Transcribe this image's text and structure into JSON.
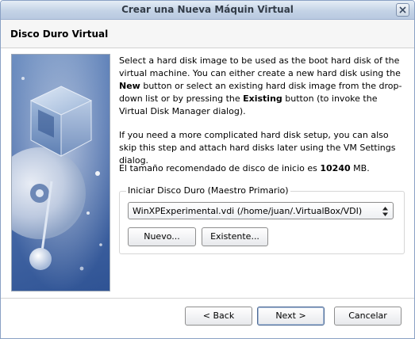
{
  "window": {
    "title": "Crear una Nueva Máquin Virtual"
  },
  "page": {
    "heading": "Disco Duro Virtual"
  },
  "description": {
    "p1": {
      "before_new": "Select a hard disk image to be used as the boot hard disk of the virtual machine. You can either create a new hard disk using the ",
      "new_word": "New",
      "mid": " button or select an existing hard disk image from the drop-down list or by pressing the ",
      "existing_word": "Existing",
      "after": " button (to invoke the Virtual Disk Manager dialog)."
    },
    "p2": "If you need a more complicated hard disk setup, you can also skip this step and attach hard disks later using the VM Settings dialog.",
    "p3": {
      "before": "El tamaño recomendado de disco de inicio es ",
      "size": "10240",
      "after": " MB."
    }
  },
  "boot_disk": {
    "label": "Iniciar Disco Duro (Maestro Primario)",
    "selected": "WinXPExperimental.vdi (/home/juan/.VirtualBox/VDI)",
    "new_button": "Nuevo...",
    "existing_button": "Existente..."
  },
  "footer": {
    "back_button": "< Back",
    "next_button": "Next >",
    "cancel_button": "Cancelar"
  },
  "icons": {
    "close": "close-icon",
    "combo_arrows": "updown-arrows-icon",
    "side_art": "virtualbox-cube-disc-image"
  },
  "colors": {
    "titlebar": "#c4d3e6",
    "side_panel": "#4d70ad"
  }
}
